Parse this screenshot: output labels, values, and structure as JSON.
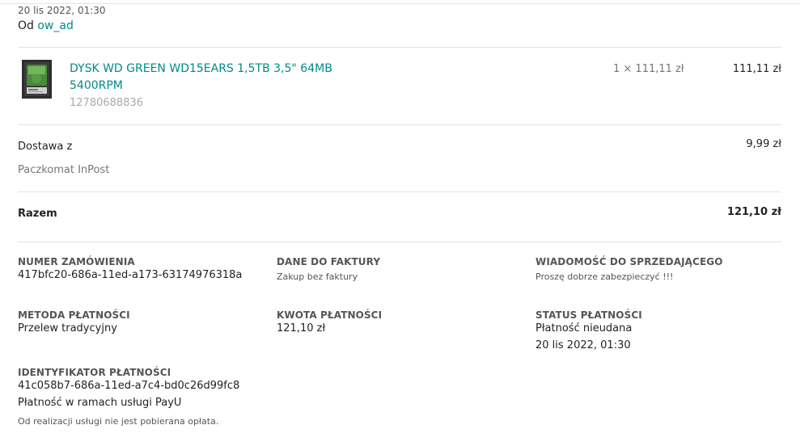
{
  "header": {
    "date": "20 lis 2022, 01:30",
    "from_prefix": "Od",
    "seller": "ow_ad"
  },
  "item": {
    "image_icon": "hard-drive-icon",
    "title_line1": "DYSK WD GREEN WD15EARS 1,5TB 3,5\" 64MB",
    "title_line2": "5400RPM",
    "offer_id": "12780688836",
    "qty_price": "1 × 111,11 zł",
    "total": "111,11 zł"
  },
  "delivery": {
    "label": "Dostawa z",
    "method": "Paczkomat InPost",
    "price": "9,99 zł"
  },
  "summary": {
    "label": "Razem",
    "total": "121,10 zł"
  },
  "details": {
    "order_number_label": "NUMER ZAMÓWIENIA",
    "order_number": "417bfc20-686a-11ed-a173-63174976318a",
    "invoice_label": "DANE DO FAKTURY",
    "invoice_value": "Zakup bez faktury",
    "message_label": "WIADOMOŚĆ DO SPRZEDAJĄCEGO",
    "message_value": "Proszę dobrze zabezpieczyć !!!",
    "payment_method_label": "METODA PŁATNOŚCI",
    "payment_method": "Przelew tradycyjny",
    "payment_amount_label": "KWOTA PŁATNOŚCI",
    "payment_amount": "121,10 zł",
    "payment_status_label": "STATUS PŁATNOŚCI",
    "payment_status": "Płatność nieudana",
    "payment_status_date": "20 lis 2022, 01:30",
    "payment_id_label": "IDENTYFIKATOR PŁATNOŚCI",
    "payment_id": "41c058b7-686a-11ed-a7c4-bd0c26d99fc8",
    "payment_service": "Płatność w ramach usługi PayU",
    "payment_fee_note": "Od realizacji usługi nie jest pobierana opłata."
  },
  "colors": {
    "link": "#008a8a",
    "divider": "#e2e2e2"
  }
}
